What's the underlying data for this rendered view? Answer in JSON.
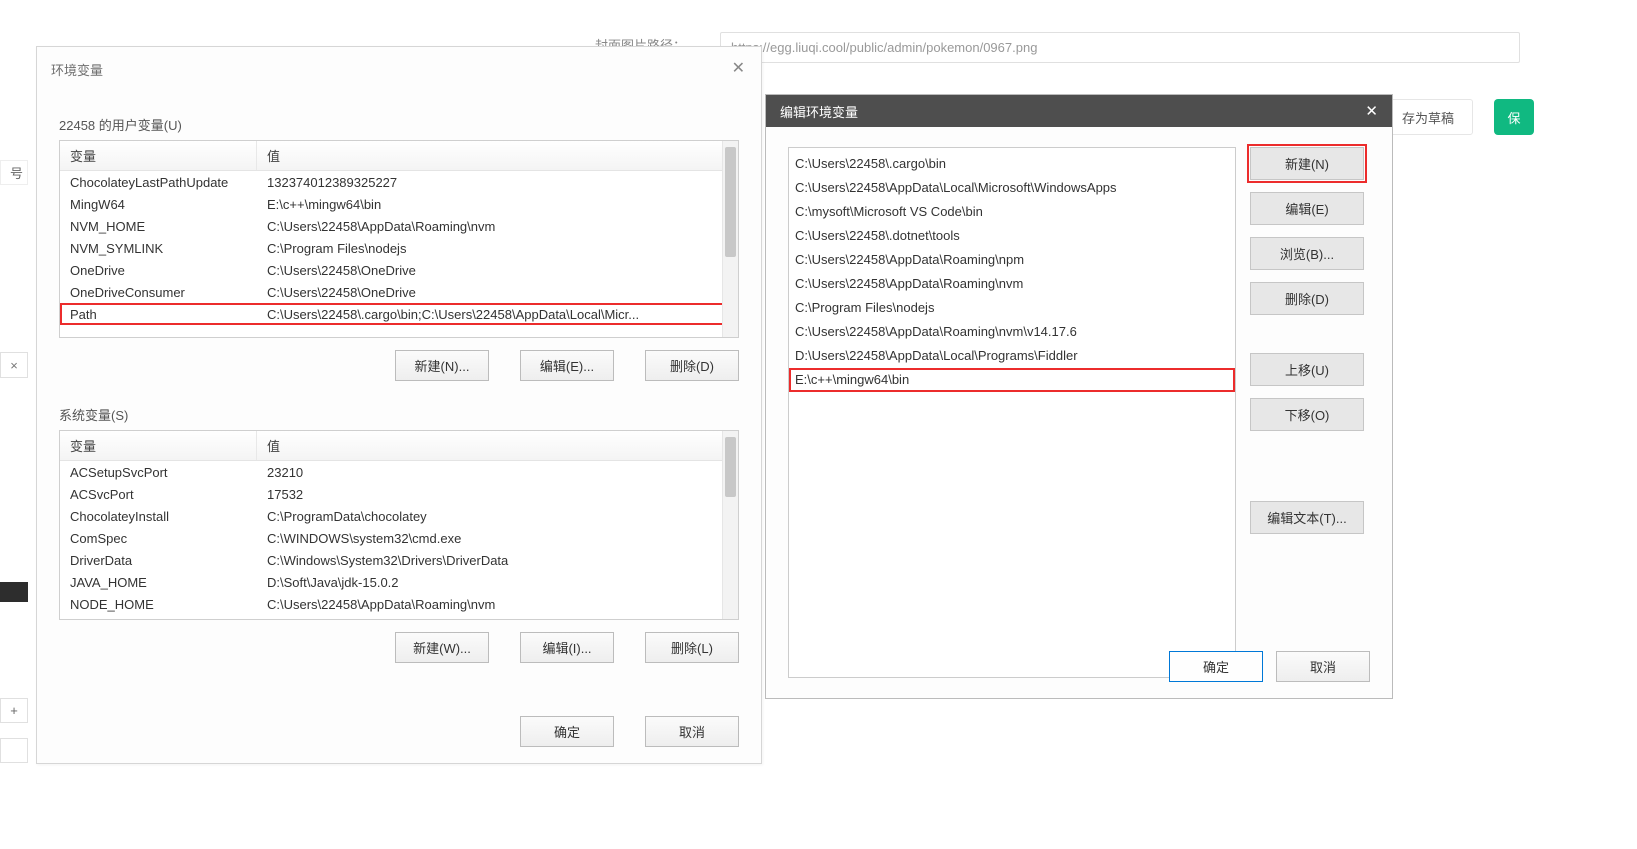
{
  "bg": {
    "url_value": "https://egg.liuqi.cool/public/admin/pokemon/0967.png",
    "cover_label_text": "封面图片路径：",
    "draft_btn": "存为草稿",
    "green_btn_label": "保",
    "frag_hao": "号",
    "frag_x": "×",
    "frag_plus": "+"
  },
  "env_dialog": {
    "title": "环境变量",
    "user_section_label": "22458 的用户变量(U)",
    "system_section_label": "系统变量(S)",
    "col_variable": "变量",
    "col_value": "值",
    "user_vars": [
      {
        "name": "ChocolateyLastPathUpdate",
        "value": "132374012389325227"
      },
      {
        "name": "MingW64",
        "value": "E:\\c++\\mingw64\\bin"
      },
      {
        "name": "NVM_HOME",
        "value": "C:\\Users\\22458\\AppData\\Roaming\\nvm"
      },
      {
        "name": "NVM_SYMLINK",
        "value": "C:\\Program Files\\nodejs"
      },
      {
        "name": "OneDrive",
        "value": "C:\\Users\\22458\\OneDrive"
      },
      {
        "name": "OneDriveConsumer",
        "value": "C:\\Users\\22458\\OneDrive"
      },
      {
        "name": "Path",
        "value": "C:\\Users\\22458\\.cargo\\bin;C:\\Users\\22458\\AppData\\Local\\Micr..."
      }
    ],
    "user_selected_index": 6,
    "system_vars": [
      {
        "name": "ACSetupSvcPort",
        "value": "23210"
      },
      {
        "name": "ACSvcPort",
        "value": "17532"
      },
      {
        "name": "ChocolateyInstall",
        "value": "C:\\ProgramData\\chocolatey"
      },
      {
        "name": "ComSpec",
        "value": "C:\\WINDOWS\\system32\\cmd.exe"
      },
      {
        "name": "DriverData",
        "value": "C:\\Windows\\System32\\Drivers\\DriverData"
      },
      {
        "name": "JAVA_HOME",
        "value": "D:\\Soft\\Java\\jdk-15.0.2"
      },
      {
        "name": "NODE_HOME",
        "value": "C:\\Users\\22458\\AppData\\Roaming\\nvm"
      }
    ],
    "buttons_user": {
      "new": "新建(N)...",
      "edit": "编辑(E)...",
      "delete": "删除(D)"
    },
    "buttons_system": {
      "new": "新建(W)...",
      "edit": "编辑(I)...",
      "delete": "删除(L)"
    },
    "ok": "确定",
    "cancel": "取消"
  },
  "edit_dialog": {
    "title": "编辑环境变量",
    "paths": [
      "C:\\Users\\22458\\.cargo\\bin",
      "C:\\Users\\22458\\AppData\\Local\\Microsoft\\WindowsApps",
      "C:\\mysoft\\Microsoft VS Code\\bin",
      "C:\\Users\\22458\\.dotnet\\tools",
      "C:\\Users\\22458\\AppData\\Roaming\\npm",
      "C:\\Users\\22458\\AppData\\Roaming\\nvm",
      "C:\\Program Files\\nodejs",
      "C:\\Users\\22458\\AppData\\Roaming\\nvm\\v14.17.6",
      "D:\\Users\\22458\\AppData\\Local\\Programs\\Fiddler",
      "E:\\c++\\mingw64\\bin"
    ],
    "highlight_index": 9,
    "buttons": {
      "new": "新建(N)",
      "edit": "编辑(E)",
      "browse": "浏览(B)...",
      "delete": "删除(D)",
      "move_up": "上移(U)",
      "move_down": "下移(O)",
      "edit_text": "编辑文本(T)...",
      "ok": "确定",
      "cancel": "取消"
    },
    "highlight_button": "new"
  }
}
